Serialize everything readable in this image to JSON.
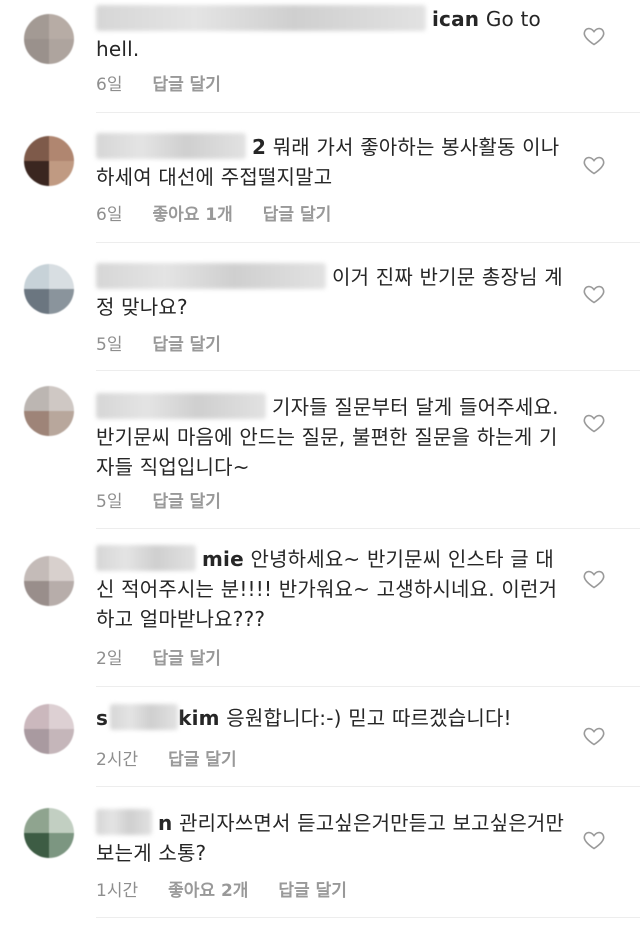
{
  "comments": [
    {
      "username_tail": "ican",
      "text": "Go to hell.",
      "age": "6일",
      "likes": "",
      "reply": "답글 달기",
      "avatar_colors": [
        "#a39a94",
        "#b7aca5",
        "#9a918c",
        "#aea49e"
      ]
    },
    {
      "username_tail": "2",
      "text": "뭐래 가서 좋아하는 봉사활동 이나 하세여 대선에 주접떨지말고",
      "age": "6일",
      "likes": "좋아요 1개",
      "reply": "답글 달기",
      "avatar_colors": [
        "#7e5a4a",
        "#b08670",
        "#3a2620",
        "#c09a82"
      ]
    },
    {
      "username_tail": "",
      "text": "이거 진짜 반기문 총장님 계정 맞나요?",
      "age": "5일",
      "likes": "",
      "reply": "답글 달기",
      "avatar_colors": [
        "#c7d2d8",
        "#d8dee2",
        "#6b7680",
        "#8a949c"
      ]
    },
    {
      "username_tail": "",
      "text": "기자들 질문부터 달게 들어주세요. 반기문씨 마음에 안드는 질문, 불편한 질문을 하는게 기자들 직업입니다~",
      "age": "5일",
      "likes": "",
      "reply": "답글 달기",
      "avatar_colors": [
        "#bcb6b2",
        "#cfc8c4",
        "#9e8478",
        "#b8a79c"
      ]
    },
    {
      "username_tail": "mie",
      "text": "안녕하세요~ 반기문씨 인스타 글 대신 적어주시는 분!!!! 반가워요~ 고생하시네요. 이런거하고 얼마받나요???",
      "age": "2일",
      "likes": "",
      "reply": "답글 달기",
      "avatar_colors": [
        "#c4bbb8",
        "#d8d0cd",
        "#998e8b",
        "#b7adaa"
      ]
    },
    {
      "username_tail": "kim",
      "username_lead": "s",
      "text": "응원합니다:-) 믿고 따르겠습니다!",
      "age": "2시간",
      "likes": "",
      "reply": "답글 달기",
      "avatar_colors": [
        "#cbb8bd",
        "#ddd0d3",
        "#a99aa0",
        "#c5b6ba"
      ]
    },
    {
      "username_tail": "n",
      "text": "관리자쓰면서 듣고싶은거만듣고 보고싶은거만 보는게 소통?",
      "age": "1시간",
      "likes": "좋아요 2개",
      "reply": "답글 달기",
      "avatar_colors": [
        "#8fa48f",
        "#c2cfc2",
        "#3d5c44",
        "#7c9681"
      ]
    }
  ],
  "icons": {
    "like": "heart-outline-icon"
  },
  "colors": {
    "text": "#262626",
    "meta": "#8e8e8e",
    "background": "#ffffff"
  }
}
